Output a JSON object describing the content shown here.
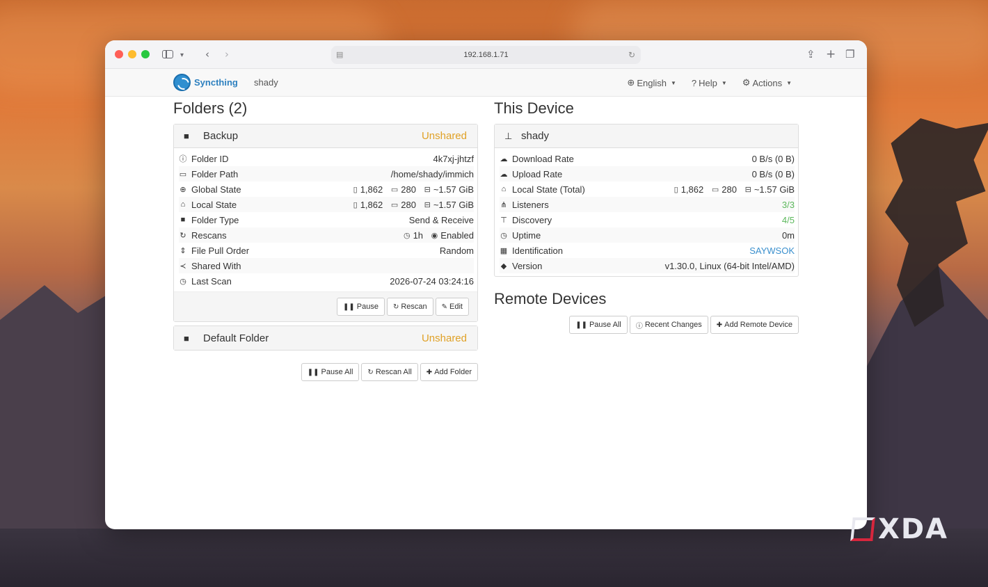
{
  "browser": {
    "address": "192.168.1.71"
  },
  "navbar": {
    "brand": "Syncthing",
    "device": "shady",
    "menu": [
      {
        "label": "English",
        "icon": "globe-icon"
      },
      {
        "label": "Help",
        "icon": "question-icon"
      },
      {
        "label": "Actions",
        "icon": "gear-icon"
      }
    ]
  },
  "folders": {
    "title": "Folders (2)",
    "items": [
      {
        "name": "Backup",
        "status": "Unshared",
        "rows": [
          {
            "label": "Folder ID",
            "value": "4k7xj-jhtzf"
          },
          {
            "label": "Folder Path",
            "value": "/home/shady/immich"
          },
          {
            "label": "Global State",
            "files": "1,862",
            "dirs": "280",
            "size": "~1.57 GiB"
          },
          {
            "label": "Local State",
            "files": "1,862",
            "dirs": "280",
            "size": "~1.57 GiB"
          },
          {
            "label": "Folder Type",
            "value": "Send & Receive"
          },
          {
            "label": "Rescans",
            "interval": "1h",
            "watch": "Enabled"
          },
          {
            "label": "File Pull Order",
            "value": "Random"
          },
          {
            "label": "Shared With",
            "value": ""
          },
          {
            "label": "Last Scan",
            "value": "2026-07-24 03:24:16"
          }
        ],
        "buttons": {
          "pause": "Pause",
          "rescan": "Rescan",
          "edit": "Edit"
        }
      },
      {
        "name": "Default Folder",
        "status": "Unshared"
      }
    ],
    "buttons": {
      "pause_all": "Pause All",
      "rescan_all": "Rescan All",
      "add_folder": "Add Folder"
    }
  },
  "this_device": {
    "title": "This Device",
    "name": "shady",
    "rows": [
      {
        "label": "Download Rate",
        "value": "0 B/s (0 B)"
      },
      {
        "label": "Upload Rate",
        "value": "0 B/s (0 B)"
      },
      {
        "label": "Local State (Total)",
        "files": "1,862",
        "dirs": "280",
        "size": "~1.57 GiB"
      },
      {
        "label": "Listeners",
        "value": "3/3"
      },
      {
        "label": "Discovery",
        "value": "4/5"
      },
      {
        "label": "Uptime",
        "value": "0m"
      },
      {
        "label": "Identification",
        "value": "SAYWSOK"
      },
      {
        "label": "Version",
        "value": "v1.30.0, Linux (64-bit Intel/AMD)"
      }
    ]
  },
  "remote_devices": {
    "title": "Remote Devices",
    "buttons": {
      "pause_all": "Pause All",
      "recent_changes": "Recent Changes",
      "add_remote": "Add Remote Device"
    }
  },
  "colors": {
    "accent": "#2d80bf",
    "unshared": "#e0a126",
    "ok": "#5cb85c",
    "link": "#3a8fcd"
  },
  "watermark": "XDA"
}
